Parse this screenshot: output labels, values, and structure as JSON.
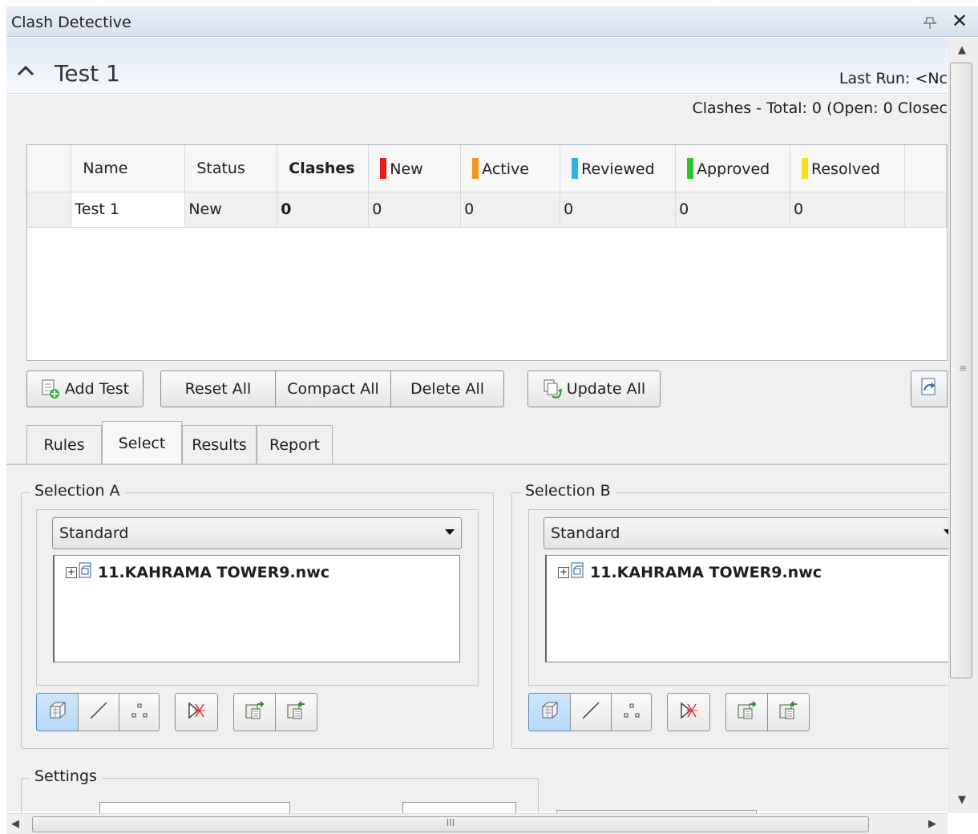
{
  "window": {
    "title": "Clash Detective"
  },
  "header": {
    "test_name": "Test 1",
    "last_run": "Last Run:  <Nc",
    "summary": "Clashes -  Total:  0  (Open:  0  Closec"
  },
  "grid": {
    "columns": [
      "Name",
      "Status",
      "Clashes",
      "New",
      "Active",
      "Reviewed",
      "Approved",
      "Resolved"
    ],
    "status_colors": {
      "New": "#e8191b",
      "Active": "#f7941d",
      "Reviewed": "#29b6e8",
      "Approved": "#2ac52a",
      "Resolved": "#f4e11a"
    },
    "rows": [
      {
        "name": "Test 1",
        "status": "New",
        "clashes": "0",
        "new": "0",
        "active": "0",
        "reviewed": "0",
        "approved": "0",
        "resolved": "0"
      }
    ]
  },
  "toolbar": {
    "add_test": "Add Test",
    "reset_all": "Reset All",
    "compact_all": "Compact All",
    "delete_all": "Delete All",
    "update_all": "Update All"
  },
  "tabs": [
    {
      "label": "Rules",
      "active": false
    },
    {
      "label": "Select",
      "active": true
    },
    {
      "label": "Results",
      "active": false
    },
    {
      "label": "Report",
      "active": false
    }
  ],
  "selection_a": {
    "title": "Selection A",
    "mode": "Standard",
    "tree_item": "11.KAHRAMA TOWER9.nwc",
    "tools": [
      "surfaces-icon",
      "lines-icon",
      "points-icon",
      "self-intersect-icon",
      "use-current-selection-icon",
      "select-in-scene-icon"
    ]
  },
  "selection_b": {
    "title": "Selection B",
    "mode": "Standard",
    "tree_item": "11.KAHRAMA TOWER9.nwc",
    "tools": [
      "surfaces-icon",
      "lines-icon",
      "points-icon",
      "self-intersect-icon",
      "use-current-selection-icon",
      "select-in-scene-icon"
    ]
  },
  "settings": {
    "title": "Settings"
  },
  "scrollbar": {
    "h_grip": "III"
  }
}
